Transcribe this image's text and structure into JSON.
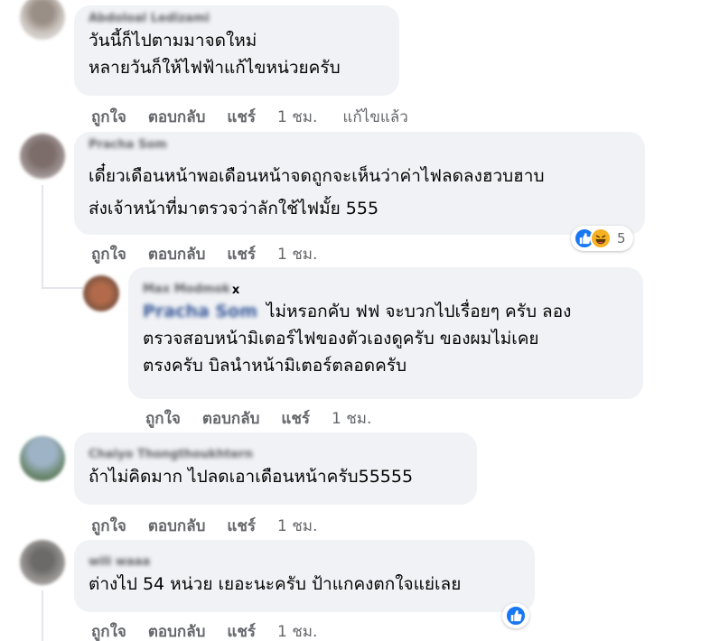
{
  "comments": [
    {
      "author": "Abdoloal Ledizami",
      "text_lines": [
        "วันนี้ก็ไปตามมาจดใหม่",
        "หลายวันก็ให้ไฟฟ้าแก้ไขหน่วยครับ"
      ],
      "actions": {
        "like": "ถูกใจ",
        "reply": "ตอบกลับ",
        "share": "แชร์",
        "time": "1 ชม.",
        "edited": "แก้ไขแล้ว"
      }
    },
    {
      "author": "Pracha Som",
      "text_lines": [
        "เดี๋ยวเดือนหน้าพอเดือนหน้าจดถูกจะเห็นว่าค่าไฟลดลงฮวบฮาบ",
        "ส่งเจ้าหน้าที่มาตรวจว่าลักใช้ไฟมั้ย 555"
      ],
      "actions": {
        "like": "ถูกใจ",
        "reply": "ตอบกลับ",
        "share": "แชร์",
        "time": "1 ชม."
      },
      "reactions": {
        "icons": [
          "like-icon",
          "haha-icon"
        ],
        "count": "5"
      }
    },
    {
      "author": "Max Modmok",
      "author_suffix": "x",
      "mention": "Pracha Som",
      "text_lines": [
        "ไม่หรอกคับ ฟฟ จะบวกไปเรื่อยๆ ครับ ลอง",
        "ตรวจสอบหน้ามิเตอร์ไฟของตัวเองดูครับ ของผมไม่เคย",
        "ตรงครับ บิลนำหน้ามิเตอร์ตลอดครับ"
      ],
      "actions": {
        "like": "ถูกใจ",
        "reply": "ตอบกลับ",
        "share": "แชร์",
        "time": "1 ชม."
      }
    },
    {
      "author": "Chaiyo Thongthoukhtern",
      "text_lines": [
        "ถ้าไม่คิดมาก ไปลดเอาเดือนหน้าครับ55555"
      ],
      "actions": {
        "like": "ถูกใจ",
        "reply": "ตอบกลับ",
        "share": "แชร์",
        "time": "1 ชม."
      }
    },
    {
      "author": "wili waaa",
      "text_lines": [
        "ต่างไป 54 หน่วย เยอะนะครับ ป้าแกคงตกใจแย่เลย"
      ],
      "actions": {
        "like": "ถูกใจ",
        "reply": "ตอบกลับ",
        "share": "แชร์",
        "time": "1 ชม."
      },
      "reactions": {
        "icons": [
          "like-icon"
        ]
      }
    }
  ],
  "colors": {
    "bubble": "#f0f2f5",
    "meta": "#65676b",
    "like": "#1877f2",
    "haha": "#f7b125"
  }
}
